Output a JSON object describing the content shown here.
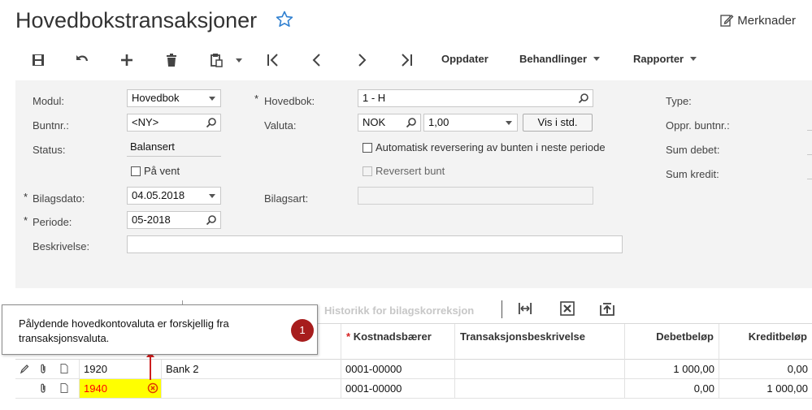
{
  "header": {
    "title": "Hovedbokstransaksjoner",
    "notes_label": "Merknader"
  },
  "toolbar": {
    "icons": [
      "save-icon",
      "undo-icon",
      "add-icon",
      "delete-icon",
      "clipboard-icon",
      "first-icon",
      "previous-icon",
      "next-icon",
      "last-icon"
    ],
    "update_label": "Oppdater",
    "actions_label": "Behandlinger",
    "reports_label": "Rapporter"
  },
  "form": {
    "module_label": "Modul:",
    "module_value": "Hovedbok",
    "batch_label": "Buntnr.:",
    "batch_value": "<NY>",
    "status_label": "Status:",
    "status_value": "Balansert",
    "on_hold_label": "På vent",
    "ledger_label": "Hovedbok:",
    "ledger_value": "1 - H",
    "currency_label": "Valuta:",
    "currency_value": "NOK",
    "rate_value": "1,00",
    "view_base_label": "Vis i std.",
    "auto_reverse_label": "Automatisk reversering av bunten i neste periode",
    "reversed_label": "Reversert bunt",
    "doc_date_label": "Bilagsdato:",
    "doc_date_value": "04.05.2018",
    "period_label": "Periode:",
    "period_value": "05-2018",
    "doc_type_label": "Bilagsart:",
    "doc_type_value": "",
    "description_label": "Beskrivelse:",
    "description_value": "",
    "type_label": "Type:",
    "orig_batch_label": "Oppr. buntnr.:",
    "sum_debit_label": "Sum debet:",
    "sum_credit_label": "Sum kredit:",
    "required_mark": "*"
  },
  "grid_toolbar": {
    "history_label": "Historikk for bilagskorreksjon"
  },
  "grid": {
    "columns": {
      "cost_center": "Kostnadsbærer",
      "description": "Transaksjonsbeskrivelse",
      "debit": "Debetbeløp",
      "credit": "Kreditbeløp"
    },
    "rows": [
      {
        "account": "1920",
        "account_desc": "Bank 2",
        "cost_center": "0001-00000",
        "description": "",
        "debit": "1 000,00",
        "credit": "0,00"
      },
      {
        "account": "1940",
        "account_desc": "",
        "cost_center": "0001-00000",
        "description": "",
        "debit": "0,00",
        "credit": "1 000,00"
      }
    ]
  },
  "tooltip": {
    "text": "Pålydende hovedkontovaluta er forskjellig fra transaksjonsvaluta.",
    "badge": "1"
  },
  "colors": {
    "error_fill": "#ffff00",
    "error_text": "#ff0000",
    "badge": "#a71d1d",
    "star": "#2f7fd0"
  }
}
